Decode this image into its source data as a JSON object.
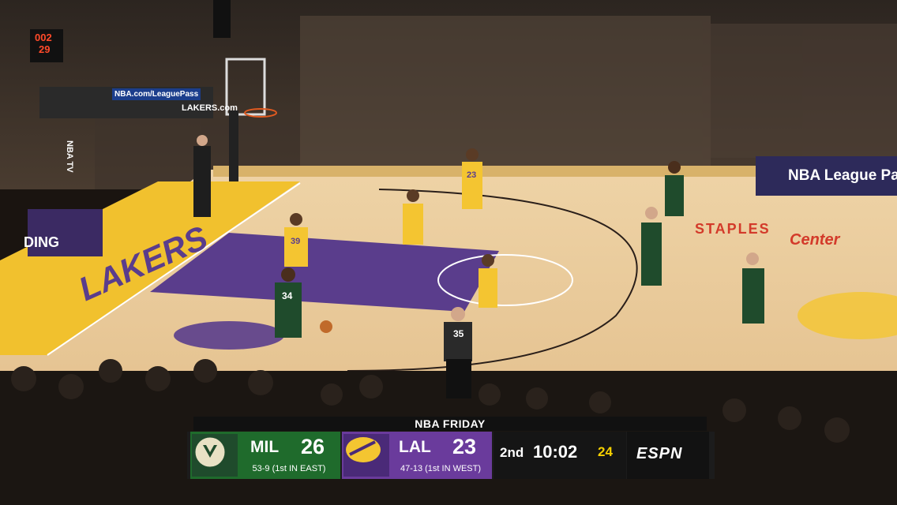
{
  "scorebug": {
    "title": "NBA FRIDAY",
    "home": {
      "abbr": "MIL",
      "score": "26",
      "record": "53-9 (1st IN EAST)",
      "color": "#1f6b2c"
    },
    "away": {
      "abbr": "LAL",
      "score": "23",
      "record": "47-13 (1st IN WEST)",
      "color": "#6a3b9c"
    },
    "period": "2nd",
    "game_clock": "10:02",
    "shot_clock": "24",
    "network": "ESPN"
  },
  "arena": {
    "shot_clock_display": "002",
    "shot_clock_seconds": "29",
    "signs": {
      "nba_com": "NBA.com/LeaguePass",
      "lakers_com": "LAKERS.com",
      "league_pass": "NBA League Pa",
      "nbatv": "NBA TV",
      "spalding": "DING",
      "staples": "STAPLES",
      "center": "Center",
      "baseline": "LAKERS"
    }
  },
  "players": [
    {
      "team": "LAL",
      "number": "39"
    },
    {
      "team": "MIL",
      "number": "34"
    },
    {
      "team": "LAL",
      "number": "23"
    },
    {
      "team": "REF",
      "number": "35"
    }
  ],
  "colors": {
    "court": "#e8c99a",
    "paint": "#5a3d8c",
    "lakers_gold": "#f4c531",
    "bucks_green": "#1f4b2c"
  }
}
